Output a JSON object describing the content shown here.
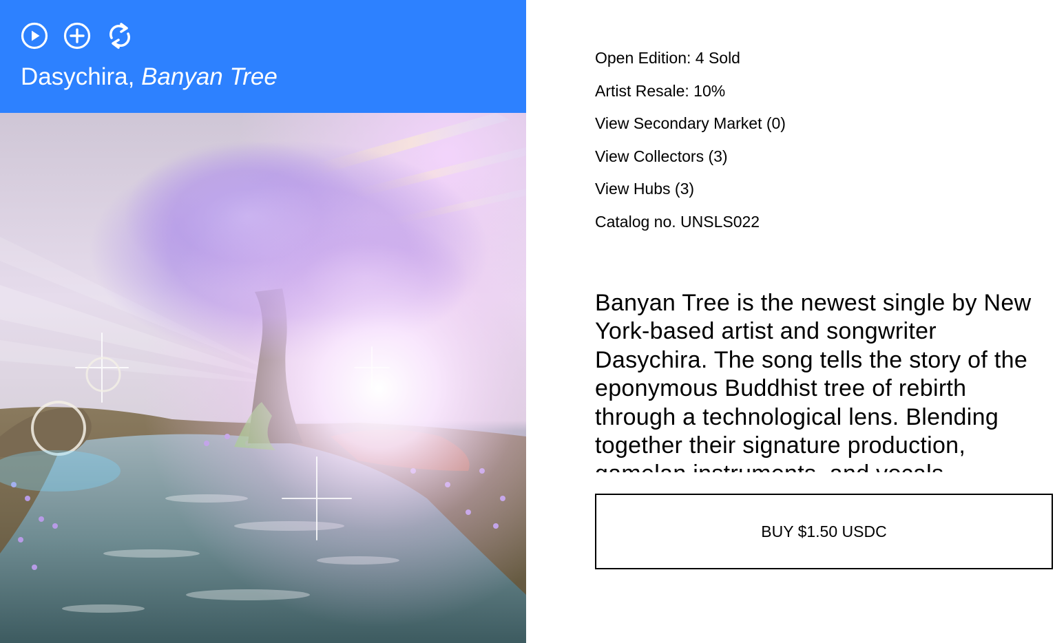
{
  "release": {
    "artist": "Dasychira",
    "separator": ", ",
    "title": "Banyan Tree"
  },
  "controls": [
    {
      "icon": "play-circle-icon"
    },
    {
      "icon": "plus-circle-icon"
    },
    {
      "icon": "refresh-icon"
    }
  ],
  "meta": {
    "edition": "Open Edition: 4 Sold",
    "resale": "Artist Resale: 10%",
    "secondary_market": "View Secondary Market (0)",
    "collectors": "View Collectors (3)",
    "hubs": "View Hubs (3)",
    "catalog": "Catalog no. UNSLS022"
  },
  "description": "Banyan Tree is the newest single by New York-based artist and songwriter Dasychira. The song tells the story of the eponymous Buddhist tree of rebirth through a technological lens. Blending together their signature production, gamelan instruments, and vocals",
  "buy_label": "BUY $1.50 USDC",
  "colors": {
    "header_bg": "#2d81ff",
    "header_text": "#ffffff"
  }
}
